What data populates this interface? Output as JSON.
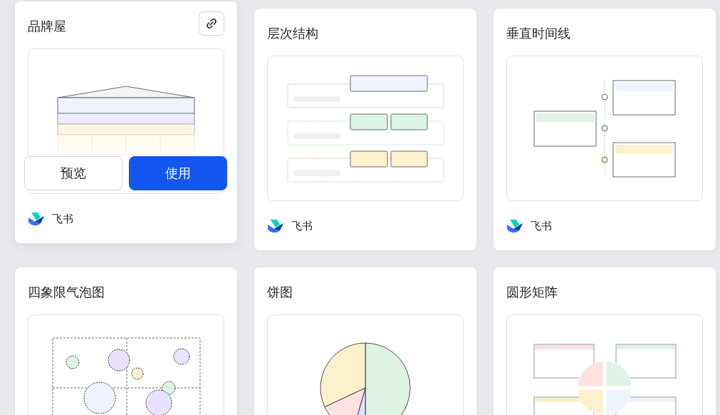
{
  "cards": [
    {
      "title": "品牌屋",
      "kind": "brand-house",
      "hovered": true,
      "actions": [
        {
          "label": "预览",
          "kind": "secondary"
        },
        {
          "label": "使用",
          "kind": "primary"
        }
      ],
      "source": "飞书"
    },
    {
      "title": "层次结构",
      "kind": "hierarchy",
      "hovered": false,
      "source": "飞书"
    },
    {
      "title": "垂直时间线",
      "kind": "vertical-timeline",
      "hovered": false,
      "source": "飞书"
    },
    {
      "title": "四象限气泡图",
      "kind": "quadrant-bubble",
      "hovered": false
    },
    {
      "title": "饼图",
      "kind": "pie",
      "hovered": false
    },
    {
      "title": "圆形矩阵",
      "kind": "circle-matrix",
      "hovered": false
    }
  ]
}
